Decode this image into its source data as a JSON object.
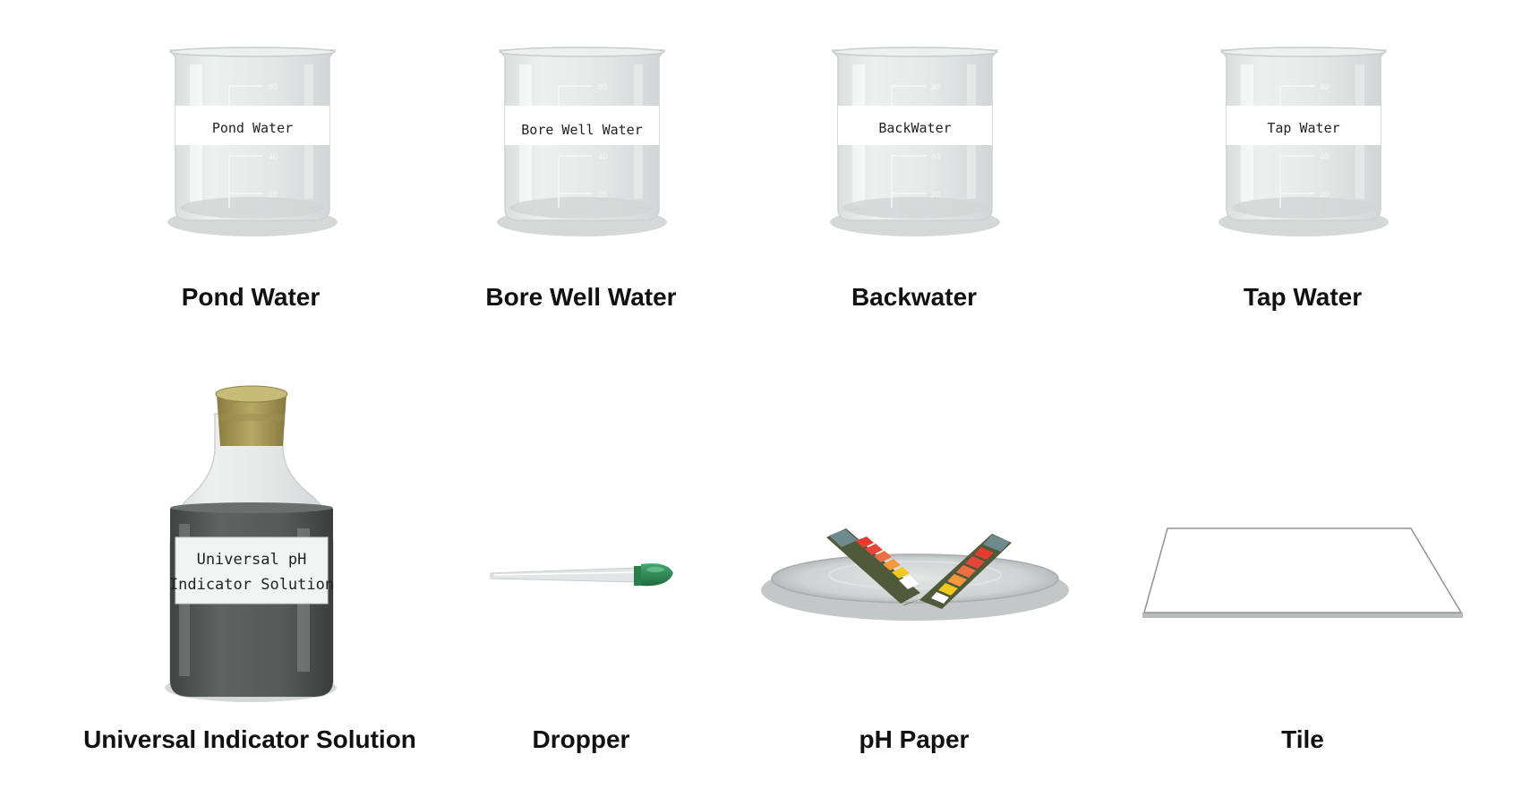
{
  "beakers": [
    {
      "label": "Pond Water",
      "caption": "Pond Water"
    },
    {
      "label": "Bore Well Water",
      "caption": "Bore Well  Water"
    },
    {
      "label": "BackWater",
      "caption": "Backwater"
    },
    {
      "label": "Tap Water",
      "caption": "Tap Water"
    }
  ],
  "beaker_scale_marks": [
    "80",
    "60",
    "40",
    "20"
  ],
  "bottle": {
    "label_line1": "Universal pH",
    "label_line2": "Indicator Solution",
    "caption": "Universal Indicator Solution"
  },
  "dropper": {
    "caption": "Dropper"
  },
  "ph_paper": {
    "caption": "pH Paper"
  },
  "tile": {
    "caption": "Tile"
  },
  "colors": {
    "glass": "#e3e6e6",
    "liquid": "#4e5250",
    "cork": "#a89a5a",
    "dropper_bulb": "#2f8a55",
    "strip_scale": [
      "#e53b2c",
      "#ef6f45",
      "#f59a3c",
      "#f2c81f",
      "#ffffff"
    ],
    "strip_body": "#4f5a3a"
  }
}
